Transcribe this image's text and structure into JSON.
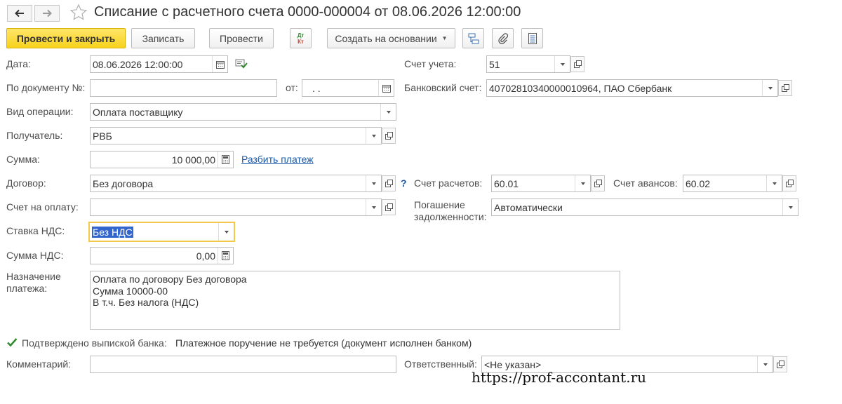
{
  "window": {
    "title": "Списание с расчетного счета 0000-000004 от 08.06.2026 12:00:00"
  },
  "toolbar": {
    "post_close_label": "Провести и закрыть",
    "save_label": "Записать",
    "post_label": "Провести",
    "dtkt_top": "Дт",
    "dtkt_bottom": "Кт",
    "create_basis_label": "Создать на основании"
  },
  "form": {
    "date_label": "Дата:",
    "date_value": "08.06.2026 12:00:00",
    "account_label": "Счет учета:",
    "account_value": "51",
    "doc_num_label": "По документу №:",
    "doc_num_value": "",
    "from_label": "от:",
    "from_value": " .  .",
    "bank_account_label": "Банковский счет:",
    "bank_account_value": "40702810340000010964, ПАО Сбербанк",
    "operation_label": "Вид операции:",
    "operation_value": "Оплата поставщику",
    "recipient_label": "Получатель:",
    "recipient_value": "РВБ",
    "amount_label": "Сумма:",
    "amount_value": "10 000,00",
    "split_payment_link": "Разбить платеж",
    "contract_label": "Договор:",
    "contract_value": "Без договора",
    "help_mark": "?",
    "settle_account_label": "Счет расчетов:",
    "settle_account_value": "60.01",
    "advance_account_label": "Счет авансов:",
    "advance_account_value": "60.02",
    "invoice_label": "Счет на оплату:",
    "invoice_value": "",
    "debt_repay_label_1": "Погашение",
    "debt_repay_label_2": "задолженности:",
    "debt_repay_value": "Автоматически",
    "vat_rate_label": "Ставка НДС:",
    "vat_rate_value": "Без НДС",
    "vat_amount_label": "Сумма НДС:",
    "vat_amount_value": "0,00",
    "purpose_label_1": "Назначение",
    "purpose_label_2": "платежа:",
    "purpose_lines": [
      "Оплата по договору Без договора",
      "Сумма 10000-00",
      "В т.ч. Без налога (НДС)"
    ],
    "confirmed_label": "Подтверждено выпиской банка:",
    "confirmed_checked": true,
    "confirmed_note": "Платежное поручение не требуется (документ исполнен банком)",
    "comment_label": "Комментарий:",
    "comment_value": "",
    "responsible_label": "Ответственный:",
    "responsible_value": "<Не указан>"
  },
  "watermark": "https://prof-accontant.ru",
  "colors": {
    "primary_button": "#f7d21c",
    "link": "#1a59a8",
    "focus_border": "#f2c94c",
    "selection": "#3366cc",
    "checkmark": "#2e8b2e"
  }
}
